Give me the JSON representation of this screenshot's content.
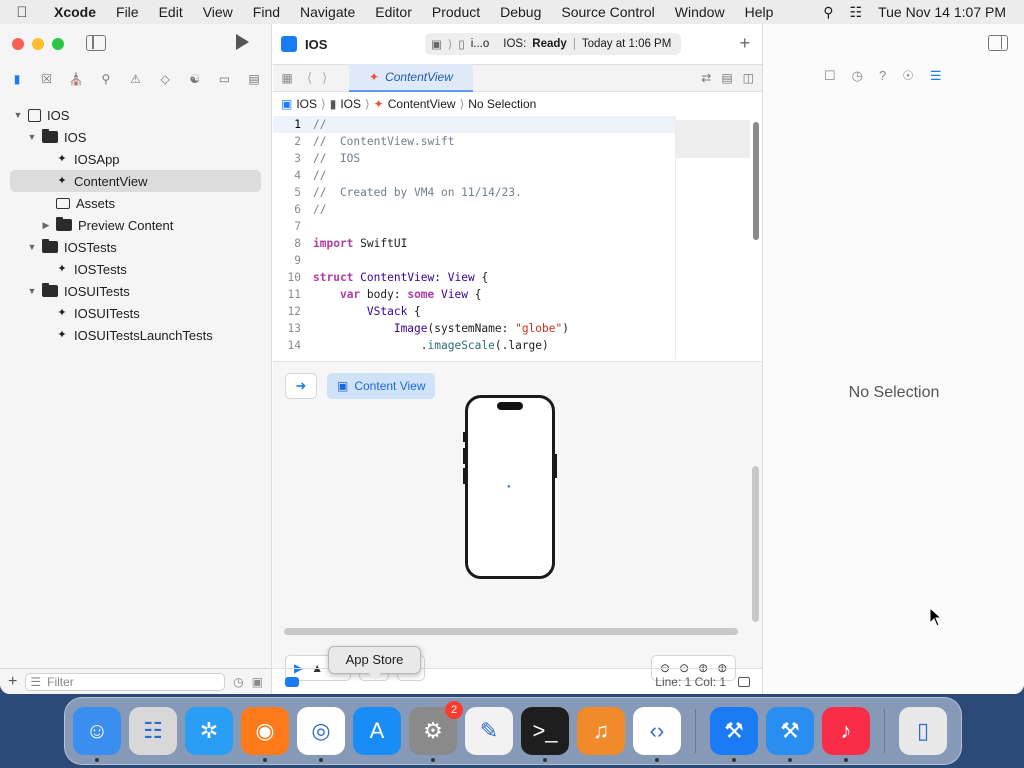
{
  "menubar": {
    "app": "Xcode",
    "items": [
      "File",
      "Edit",
      "View",
      "Find",
      "Navigate",
      "Editor",
      "Product",
      "Debug",
      "Source Control",
      "Window",
      "Help"
    ],
    "datetime": "Tue Nov 14  1:07 PM"
  },
  "toolbar": {
    "project_title": "IOS",
    "scheme": "i...o",
    "status_project": "IOS:",
    "status_state": "Ready",
    "status_time": "Today at 1:06 PM"
  },
  "tab": {
    "label": "ContentView"
  },
  "breadcrumb": [
    "IOS",
    "IOS",
    "ContentView",
    "No Selection"
  ],
  "tree": [
    {
      "label": "IOS",
      "level": 0,
      "icon": "project-icon",
      "expanded": true
    },
    {
      "label": "IOS",
      "level": 1,
      "icon": "folder-icon",
      "expanded": true
    },
    {
      "label": "IOSApp",
      "level": 2,
      "icon": "swift-file-icon"
    },
    {
      "label": "ContentView",
      "level": 2,
      "icon": "swift-file-icon",
      "selected": true
    },
    {
      "label": "Assets",
      "level": 2,
      "icon": "assets-icon"
    },
    {
      "label": "Preview Content",
      "level": 2,
      "icon": "folder-icon",
      "collapsed": true
    },
    {
      "label": "IOSTests",
      "level": 1,
      "icon": "folder-icon",
      "expanded": true
    },
    {
      "label": "IOSTests",
      "level": 2,
      "icon": "swift-file-icon"
    },
    {
      "label": "IOSUITests",
      "level": 1,
      "icon": "folder-icon",
      "expanded": true
    },
    {
      "label": "IOSUITests",
      "level": 2,
      "icon": "swift-file-icon"
    },
    {
      "label": "IOSUITestsLaunchTests",
      "level": 2,
      "icon": "swift-file-icon"
    }
  ],
  "filter": {
    "placeholder": "Filter"
  },
  "code": [
    {
      "n": "1",
      "t": [
        [
          "c",
          "//"
        ]
      ]
    },
    {
      "n": "2",
      "t": [
        [
          "c",
          "//  ContentView.swift"
        ]
      ]
    },
    {
      "n": "3",
      "t": [
        [
          "c",
          "//  IOS"
        ]
      ]
    },
    {
      "n": "4",
      "t": [
        [
          "c",
          "//"
        ]
      ]
    },
    {
      "n": "5",
      "t": [
        [
          "c",
          "//  Created by VM4 on 11/14/23."
        ]
      ]
    },
    {
      "n": "6",
      "t": [
        [
          "c",
          "//"
        ]
      ]
    },
    {
      "n": "7",
      "t": []
    },
    {
      "n": "8",
      "t": [
        [
          "k",
          "import"
        ],
        [
          "p",
          " SwiftUI"
        ]
      ]
    },
    {
      "n": "9",
      "t": []
    },
    {
      "n": "10",
      "t": [
        [
          "k",
          "struct"
        ],
        [
          "p",
          " "
        ],
        [
          "y",
          "ContentView"
        ],
        [
          "p",
          ": "
        ],
        [
          "y",
          "View"
        ],
        [
          "p",
          " {"
        ]
      ]
    },
    {
      "n": "11",
      "t": [
        [
          "p",
          "    "
        ],
        [
          "k",
          "var"
        ],
        [
          "p",
          " body: "
        ],
        [
          "k",
          "some"
        ],
        [
          "p",
          " "
        ],
        [
          "y",
          "View"
        ],
        [
          "p",
          " {"
        ]
      ]
    },
    {
      "n": "12",
      "t": [
        [
          "p",
          "        "
        ],
        [
          "y",
          "VStack"
        ],
        [
          "p",
          " {"
        ]
      ]
    },
    {
      "n": "13",
      "t": [
        [
          "p",
          "            "
        ],
        [
          "y",
          "Image"
        ],
        [
          "p",
          "(systemName: "
        ],
        [
          "s",
          "\"globe\""
        ],
        [
          "p",
          ")"
        ]
      ]
    },
    {
      "n": "14",
      "t": [
        [
          "p",
          "                ."
        ],
        [
          "f",
          "imageScale"
        ],
        [
          "p",
          "(.large)"
        ]
      ]
    }
  ],
  "preview": {
    "chip_label": "Content View"
  },
  "statusbar": {
    "position": "Line: 1  Col: 1"
  },
  "inspector": {
    "empty_label": "No Selection"
  },
  "tooltip": {
    "label": "App Store"
  },
  "dock": [
    {
      "name": "finder",
      "color": "#3a8ef0"
    },
    {
      "name": "launchpad",
      "color": "#d8d8d8"
    },
    {
      "name": "safari",
      "color": "#2a9df4"
    },
    {
      "name": "firefox",
      "color": "#ff7a1a"
    },
    {
      "name": "chrome",
      "color": "#ffffff"
    },
    {
      "name": "app-store",
      "color": "#1a8cf5"
    },
    {
      "name": "system-settings",
      "color": "#8a8a8a",
      "badge": "2"
    },
    {
      "name": "textedit",
      "color": "#f2f2f2"
    },
    {
      "name": "terminal",
      "color": "#1e1e1e"
    },
    {
      "name": "garageband",
      "color": "#f08a2a"
    },
    {
      "name": "vscode",
      "color": "#ffffff"
    },
    {
      "name": "xcode",
      "color": "#1a7cf5"
    },
    {
      "name": "simulator",
      "color": "#2a8ef0"
    },
    {
      "name": "music",
      "color": "#fa2d48"
    },
    {
      "name": "trash",
      "color": "#e8e8e8"
    }
  ]
}
